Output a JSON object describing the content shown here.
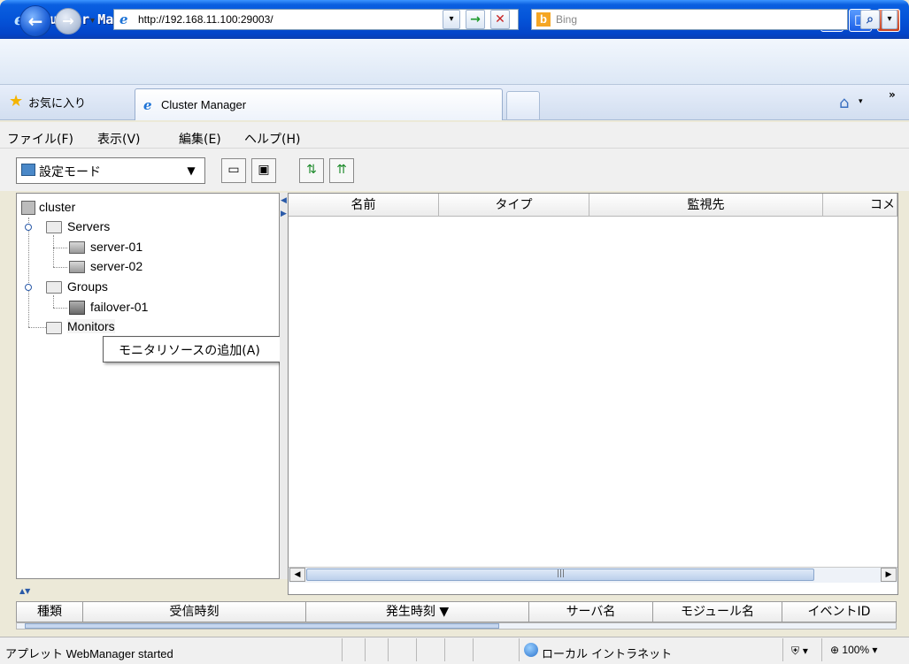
{
  "window": {
    "title": "Cluster Manager - Windows Internet Explorer",
    "min_glyph": "▁",
    "max_glyph": "□",
    "close_glyph": "✕"
  },
  "browser": {
    "address": "http://192.168.11.100:29003/",
    "search_placeholder": "Bing",
    "favorites_label": "お気に入り",
    "tab_title": "Cluster Manager",
    "chevron": "»",
    "accent_color": "#0453d8"
  },
  "icons": {
    "back": "back-arrow-icon",
    "forward": "forward-arrow-icon",
    "refresh": "go-arrow-icon",
    "stop": "stop-icon",
    "search": "search-icon",
    "home": "home-icon",
    "favorites": "star-icon"
  },
  "glyphs": {
    "back": "←",
    "forward": "→",
    "go": "→",
    "stop": "✕",
    "search": "⌕",
    "dropdown": "▾",
    "home": "⌂",
    "star": "★",
    "ie": "e",
    "bing": "b"
  },
  "menu": [
    {
      "label": "ファイル(F)"
    },
    {
      "label": "表示(V)"
    },
    {
      "label": "編集(E)"
    },
    {
      "label": "ヘルプ(H)"
    }
  ],
  "toolbar": {
    "mode_label": "設定モード",
    "buttons": [
      "open-icon",
      "save-icon",
      "apply-icon",
      "upload-icon"
    ]
  },
  "tree": {
    "root": "cluster",
    "servers_label": "Servers",
    "servers": [
      "server-01",
      "server-02"
    ],
    "groups_label": "Groups",
    "groups": [
      "failover-01"
    ],
    "monitors_label": "Monitors"
  },
  "context_menu": {
    "item": "モニタリソースの追加(A)"
  },
  "list": {
    "columns": [
      "名前",
      "タイプ",
      "監視先",
      "コメ"
    ]
  },
  "log": {
    "columns": [
      "種類",
      "受信時刻",
      "発生時刻 ▼",
      "サーバ名",
      "モジュール名",
      "イベントID"
    ]
  },
  "status": {
    "text": "アプレット WebManager started",
    "zone": "ローカル イントラネット",
    "zoom": "100%"
  }
}
